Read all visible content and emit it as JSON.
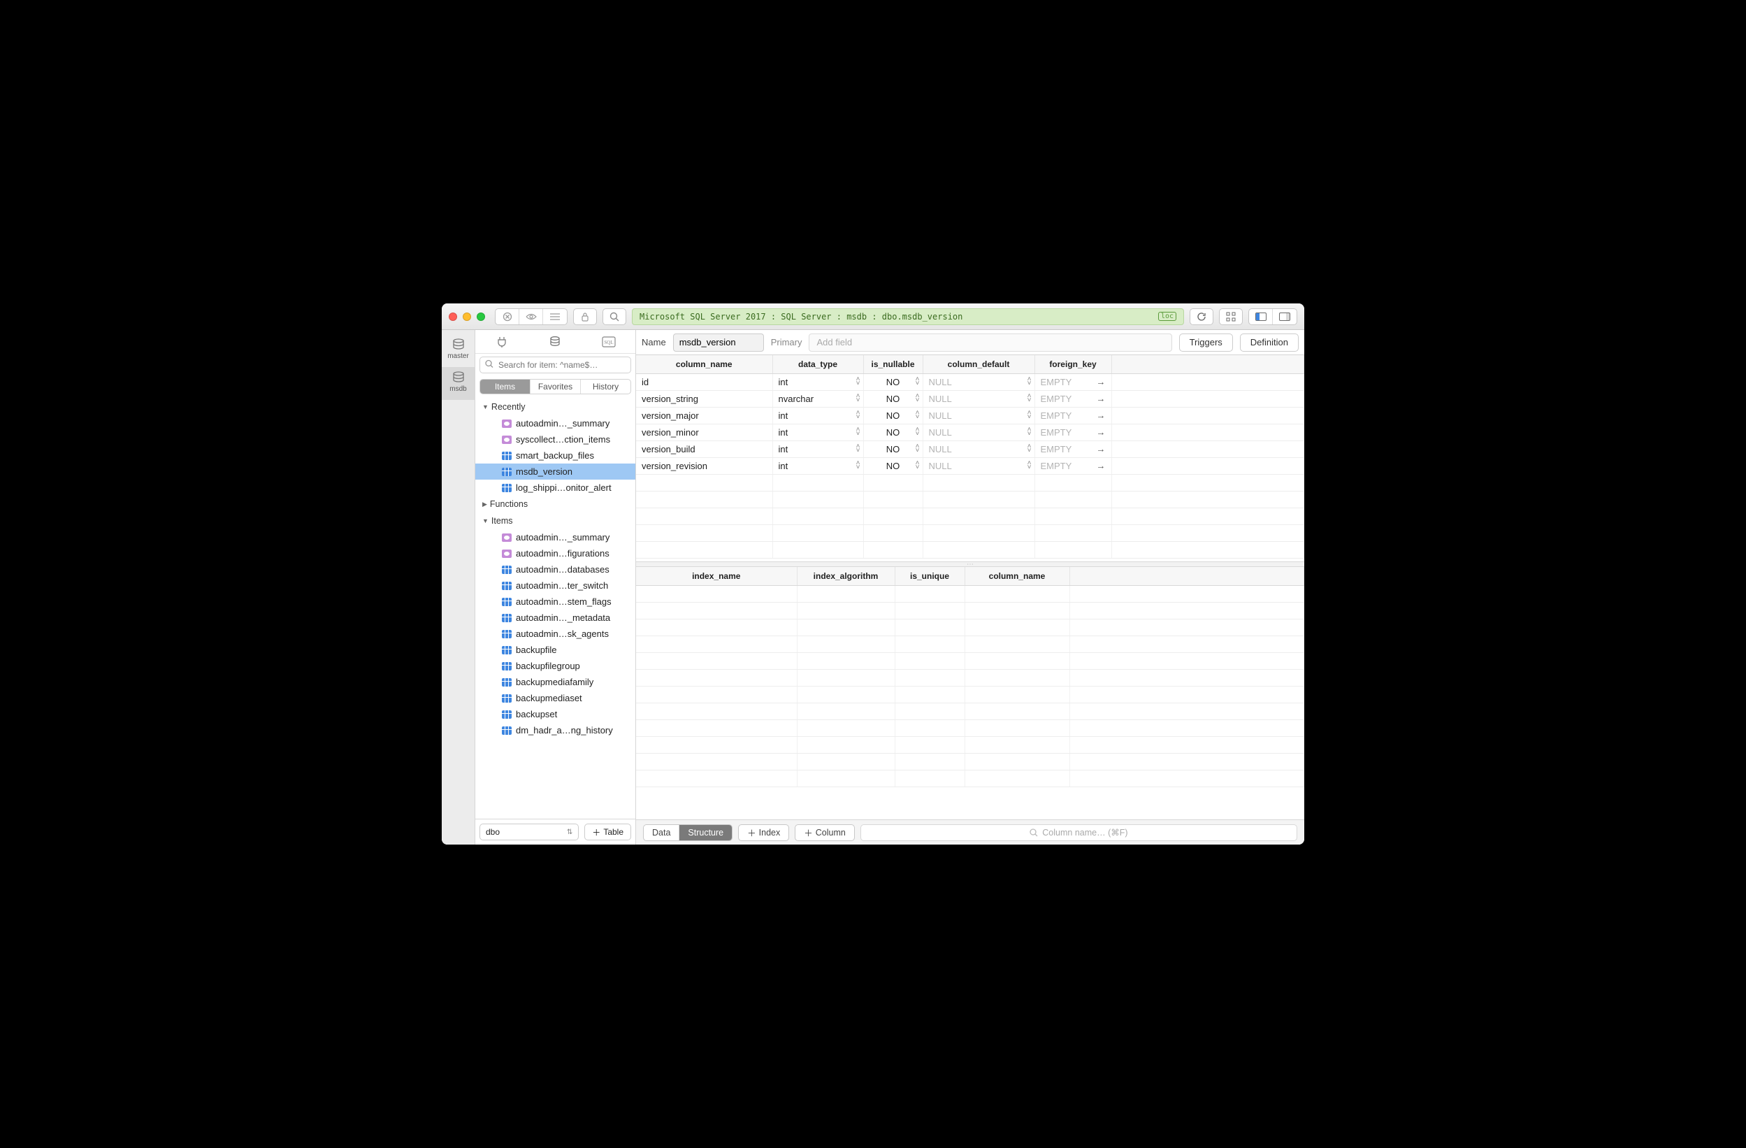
{
  "titlebar": {
    "breadcrumb": "Microsoft SQL Server 2017 : SQL Server : msdb : dbo.msdb_version",
    "env_badge": "loc"
  },
  "db_rail": [
    {
      "name": "master",
      "active": false
    },
    {
      "name": "msdb",
      "active": true
    }
  ],
  "sidebar": {
    "search_placeholder": "Search for item: ^name$…",
    "segments": [
      "Items",
      "Favorites",
      "History"
    ],
    "segment_active": 0
  },
  "tree": {
    "recently_label": "Recently",
    "recently": [
      {
        "icon": "view",
        "label": "autoadmin…_summary"
      },
      {
        "icon": "view",
        "label": "syscollect…ction_items"
      },
      {
        "icon": "table",
        "label": "smart_backup_files"
      },
      {
        "icon": "table",
        "label": "msdb_version",
        "selected": true
      },
      {
        "icon": "table",
        "label": "log_shippi…onitor_alert"
      }
    ],
    "functions_label": "Functions",
    "items_label": "Items",
    "items": [
      {
        "icon": "view",
        "label": "autoadmin…_summary"
      },
      {
        "icon": "view",
        "label": "autoadmin…figurations"
      },
      {
        "icon": "table",
        "label": "autoadmin…databases"
      },
      {
        "icon": "table",
        "label": "autoadmin…ter_switch"
      },
      {
        "icon": "table",
        "label": "autoadmin…stem_flags"
      },
      {
        "icon": "table",
        "label": "autoadmin…_metadata"
      },
      {
        "icon": "table",
        "label": "autoadmin…sk_agents"
      },
      {
        "icon": "table",
        "label": "backupfile"
      },
      {
        "icon": "table",
        "label": "backupfilegroup"
      },
      {
        "icon": "table",
        "label": "backupmediafamily"
      },
      {
        "icon": "table",
        "label": "backupmediaset"
      },
      {
        "icon": "table",
        "label": "backupset"
      },
      {
        "icon": "table",
        "label": "dm_hadr_a…ng_history"
      }
    ],
    "footer_schema": "dbo",
    "footer_add_label": "Table"
  },
  "editor": {
    "name_label": "Name",
    "table_name": "msdb_version",
    "primary_label": "Primary",
    "add_field_placeholder": "Add field",
    "triggers_btn": "Triggers",
    "definition_btn": "Definition"
  },
  "columns_grid": {
    "headers": [
      "column_name",
      "data_type",
      "is_nullable",
      "column_default",
      "foreign_key"
    ],
    "rows": [
      {
        "name": "id",
        "type": "int",
        "nullable": "NO",
        "default": "NULL",
        "fk": "EMPTY"
      },
      {
        "name": "version_string",
        "type": "nvarchar",
        "nullable": "NO",
        "default": "NULL",
        "fk": "EMPTY"
      },
      {
        "name": "version_major",
        "type": "int",
        "nullable": "NO",
        "default": "NULL",
        "fk": "EMPTY"
      },
      {
        "name": "version_minor",
        "type": "int",
        "nullable": "NO",
        "default": "NULL",
        "fk": "EMPTY"
      },
      {
        "name": "version_build",
        "type": "int",
        "nullable": "NO",
        "default": "NULL",
        "fk": "EMPTY"
      },
      {
        "name": "version_revision",
        "type": "int",
        "nullable": "NO",
        "default": "NULL",
        "fk": "EMPTY"
      }
    ]
  },
  "index_grid": {
    "headers": [
      "index_name",
      "index_algorithm",
      "is_unique",
      "column_name"
    ]
  },
  "bottom": {
    "tabs": [
      "Data",
      "Structure"
    ],
    "tab_active": 1,
    "add_index": "Index",
    "add_column": "Column",
    "search_placeholder": "Column name… (⌘F)"
  }
}
